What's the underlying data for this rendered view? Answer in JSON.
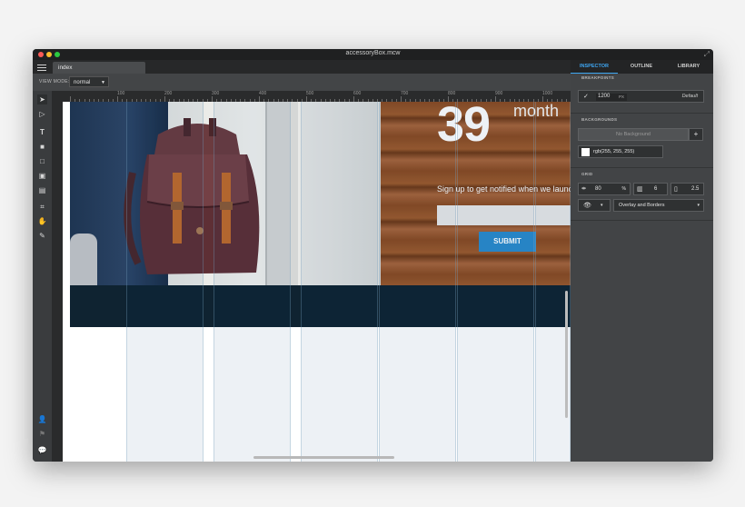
{
  "window": {
    "title": "accessoryBox.mcw"
  },
  "tabs": [
    {
      "label": "index"
    }
  ],
  "toolbar": {
    "view_mode_label": "VIEW MODE:",
    "view_mode_value": "normal"
  },
  "ruler": {
    "marks": [
      "100",
      "200",
      "300",
      "400",
      "500",
      "600",
      "700",
      "800",
      "900",
      "1000"
    ]
  },
  "canvas": {
    "counter_number": "39",
    "counter_unit": "month",
    "signup_text": "Sign up to get notified when we launch",
    "submit_label": "SUBMIT"
  },
  "inspector": {
    "tabs": [
      "INSPECTOR",
      "OUTLINE",
      "LIBRARY"
    ],
    "breakpoints": {
      "header": "BREAKPOINTS",
      "value": "1200",
      "unit": "PX",
      "default_label": "Default"
    },
    "backgrounds": {
      "header": "BACKGROUNDS",
      "none_label": "No Background",
      "add_label": "+",
      "color_value": "rgb(255, 255, 255)"
    },
    "grid": {
      "header": "GRID",
      "width_value": "80",
      "width_unit": "%",
      "columns_value": "6",
      "gutter_value": "2.5",
      "overlay_value": "Overlay and Borders"
    }
  },
  "colors": {
    "accent": "#3ea6f2",
    "submit": "#2b8acc",
    "band": "#0f2331"
  },
  "icons": [
    "menu-icon",
    "select-arrow-icon",
    "direct-select-icon",
    "text-icon",
    "rectangle-icon",
    "box-icon",
    "image-icon",
    "widget-icon",
    "crop-icon",
    "hand-icon",
    "eyedropper-icon",
    "user-icon",
    "flag-icon",
    "comment-icon",
    "checkmark-icon",
    "eye-icon",
    "expand-icon"
  ]
}
